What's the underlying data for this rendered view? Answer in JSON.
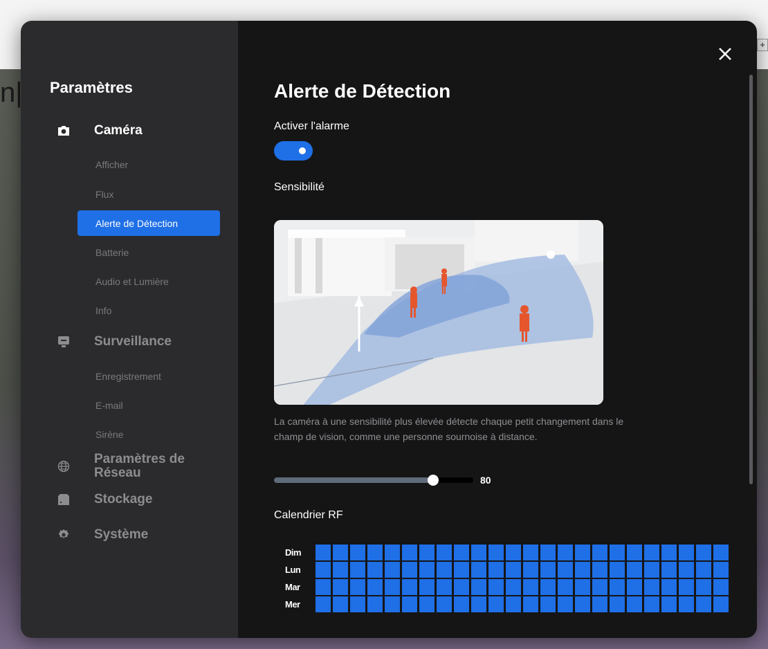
{
  "background": {
    "partial_text": "n|",
    "plus_icon": "+"
  },
  "sidebar": {
    "title": "Paramètres",
    "sections": [
      {
        "label": "Caméra",
        "icon": "camera-icon",
        "sub": [
          "Afficher",
          "Flux",
          "Alerte de Détection",
          "Batterie",
          "Audio et Lumière",
          "Info"
        ],
        "selected": "Alerte de Détection"
      },
      {
        "label": "Surveillance",
        "icon": "monitor-icon",
        "sub": [
          "Enregistrement",
          "E-mail",
          "Sirène"
        ]
      },
      {
        "label": "Paramètres de Réseau",
        "icon": "globe-icon",
        "sub": []
      },
      {
        "label": "Stockage",
        "icon": "storage-icon",
        "sub": []
      },
      {
        "label": "Système",
        "icon": "gear-icon",
        "sub": []
      }
    ]
  },
  "content": {
    "title": "Alerte de Détection",
    "alarm_label": "Activer l'alarme",
    "alarm_enabled": true,
    "sensitivity_label": "Sensibilité",
    "sensitivity_description": "La caméra à une sensibilité plus élevée détecte chaque petit changement dans le champ de vision, comme une personne sournoise à distance.",
    "sensitivity_value": "80",
    "sensitivity_fraction": 0.8,
    "calendar_label": "Calendrier RF",
    "calendar_days": [
      "Dim",
      "Lun",
      "Mar",
      "Mer"
    ],
    "calendar_hours": 24,
    "colors": {
      "accent": "#1f6fe6",
      "sidebar_bg": "#2b2b2d",
      "content_bg": "#151516"
    }
  }
}
